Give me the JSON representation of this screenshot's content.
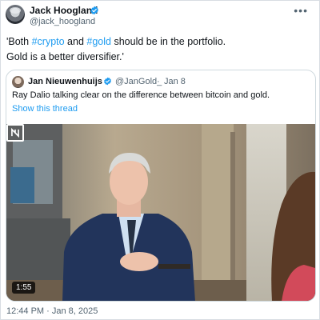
{
  "author": {
    "name": "Jack Hoogland",
    "handle": "@jack_hoogland",
    "verified": true,
    "more_icon": "more-horizontal-icon"
  },
  "tweet": {
    "text_line1_prefix": "'Both ",
    "hashtag_crypto": "#crypto",
    "text_line1_mid": " and ",
    "hashtag_gold": "#gold",
    "text_line1_suffix": " should be in the portfolio.",
    "text_line2": "Gold is a better diversifier.'"
  },
  "quoted_tweet": {
    "name": "Jan Nieuwenhuijs",
    "handle": "@JanGold_",
    "separator": "·",
    "time": "Jan 8",
    "text": "Ray Dalio talking clear on the difference between bitcoin and gold.",
    "show_thread": "Show this thread",
    "video": {
      "duration": "1:55",
      "logo_icon": "n-logo-icon"
    }
  },
  "timestamp": "12:44 PM · Jan 8, 2025",
  "colors": {
    "link": "#1d9bf0",
    "text": "#0f1419",
    "secondary": "#536471",
    "border": "#cfd9de"
  }
}
